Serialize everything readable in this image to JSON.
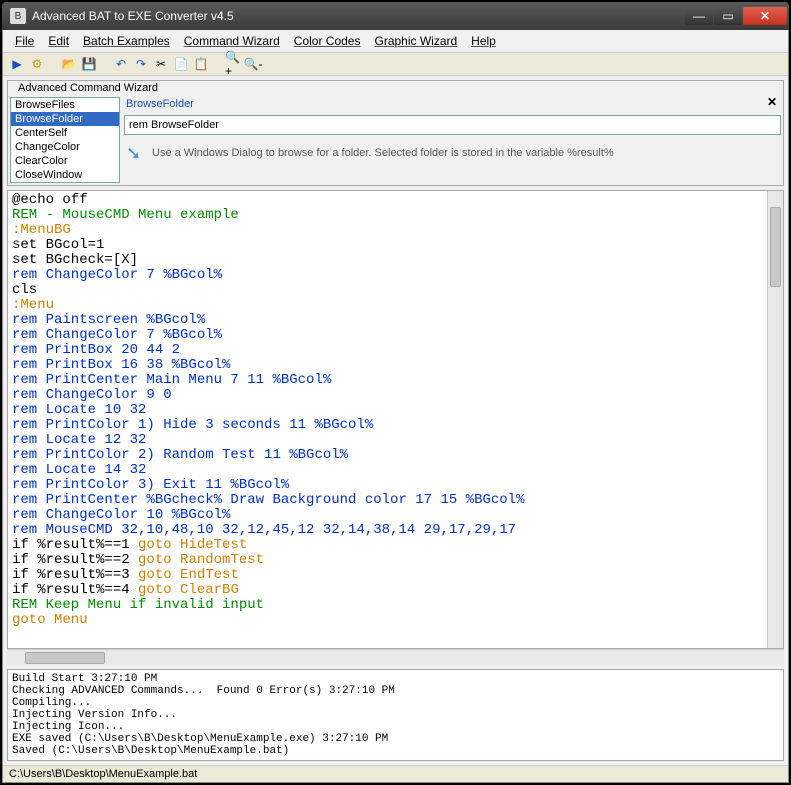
{
  "title": "Advanced BAT to EXE Converter v4.5",
  "menu": [
    "File",
    "Edit",
    "Batch Examples",
    "Command Wizard",
    "Color Codes",
    "Graphic Wizard",
    "Help"
  ],
  "toolbar_icons": [
    "play-icon",
    "gear-icon",
    "open-icon",
    "save-icon",
    "undo-icon",
    "redo-icon",
    "cut-icon",
    "copy-icon",
    "paste-icon",
    "find-icon",
    "zoom-in-icon",
    "zoom-out-icon"
  ],
  "wizard": {
    "panel_label": "Advanced Command Wizard",
    "selected": "BrowseFolder",
    "items": [
      "BrowseFiles",
      "BrowseFolder",
      "CenterSelf",
      "ChangeColor",
      "ClearColor",
      "CloseWindow"
    ],
    "title": "BrowseFolder",
    "input": "rem BrowseFolder",
    "description": "Use a Windows Dialog to browse for a folder. Selected folder is stored in the variable %result%"
  },
  "editor": {
    "lines": [
      {
        "cls": "k",
        "t": "@echo off"
      },
      {
        "cls": "g",
        "t": "REM - MouseCMD Menu example"
      },
      {
        "cls": "o",
        "t": ":MenuBG"
      },
      {
        "cls": "k",
        "t": "set BGcol=1"
      },
      {
        "cls": "k",
        "t": "set BGcheck=[X]"
      },
      {
        "cls": "b",
        "t": "rem ChangeColor 7 %BGcol%"
      },
      {
        "cls": "k",
        "t": "cls"
      },
      {
        "cls": "o",
        "t": ":Menu"
      },
      {
        "cls": "b",
        "t": "rem Paintscreen %BGcol%"
      },
      {
        "cls": "b",
        "t": "rem ChangeColor 7 %BGcol%"
      },
      {
        "cls": "b",
        "t": "rem PrintBox 20 44 2"
      },
      {
        "cls": "b",
        "t": "rem PrintBox 16 38 %BGcol%"
      },
      {
        "cls": "b",
        "t": "rem PrintCenter Main Menu 7 11 %BGcol%"
      },
      {
        "cls": "b",
        "t": "rem ChangeColor 9 0"
      },
      {
        "cls": "b",
        "t": "rem Locate 10 32"
      },
      {
        "cls": "b",
        "t": "rem PrintColor 1) Hide 3 seconds 11 %BGcol%"
      },
      {
        "cls": "b",
        "t": "rem Locate 12 32"
      },
      {
        "cls": "b",
        "t": "rem PrintColor 2) Random Test 11 %BGcol%"
      },
      {
        "cls": "b",
        "t": "rem Locate 14 32"
      },
      {
        "cls": "b",
        "t": "rem PrintColor 3) Exit 11 %BGcol%"
      },
      {
        "cls": "b",
        "t": "rem PrintCenter %BGcheck% Draw Background color 17 15 %BGcol%"
      },
      {
        "cls": "b",
        "t": "rem ChangeColor 10 %BGcol%"
      },
      {
        "cls": "b",
        "t": "rem MouseCMD 32,10,48,10 32,12,45,12 32,14,38,14 29,17,29,17"
      },
      {
        "cls": "mix",
        "t": "if %result%==1 ",
        "t2": "goto HideTest"
      },
      {
        "cls": "mix",
        "t": "if %result%==2 ",
        "t2": "goto RandomTest"
      },
      {
        "cls": "mix",
        "t": "if %result%==3 ",
        "t2": "goto EndTest"
      },
      {
        "cls": "mix",
        "t": "if %result%==4 ",
        "t2": "goto ClearBG"
      },
      {
        "cls": "g",
        "t": "REM Keep Menu if invalid input"
      },
      {
        "cls": "o",
        "t": "goto Menu"
      }
    ]
  },
  "output": [
    "Build Start 3:27:10 PM",
    "Checking ADVANCED Commands...  Found 0 Error(s) 3:27:10 PM",
    "Compiling...",
    "Injecting Version Info...",
    "Injecting Icon...",
    "EXE saved (C:\\Users\\B\\Desktop\\MenuExample.exe) 3:27:10 PM",
    "Saved (C:\\Users\\B\\Desktop\\MenuExample.bat)"
  ],
  "status": "C:\\Users\\B\\Desktop\\MenuExample.bat",
  "glyphs": {
    "play-icon": "▶",
    "gear-icon": "⚙",
    "open-icon": "📂",
    "save-icon": "💾",
    "undo-icon": "↶",
    "redo-icon": "↷",
    "cut-icon": "✂",
    "copy-icon": "📄",
    "paste-icon": "📋",
    "find-icon": "🔍",
    "zoom-in-icon": "🔍+",
    "zoom-out-icon": "🔍-"
  },
  "win_btns": {
    "min": "—",
    "max": "▭",
    "close": "✕"
  }
}
